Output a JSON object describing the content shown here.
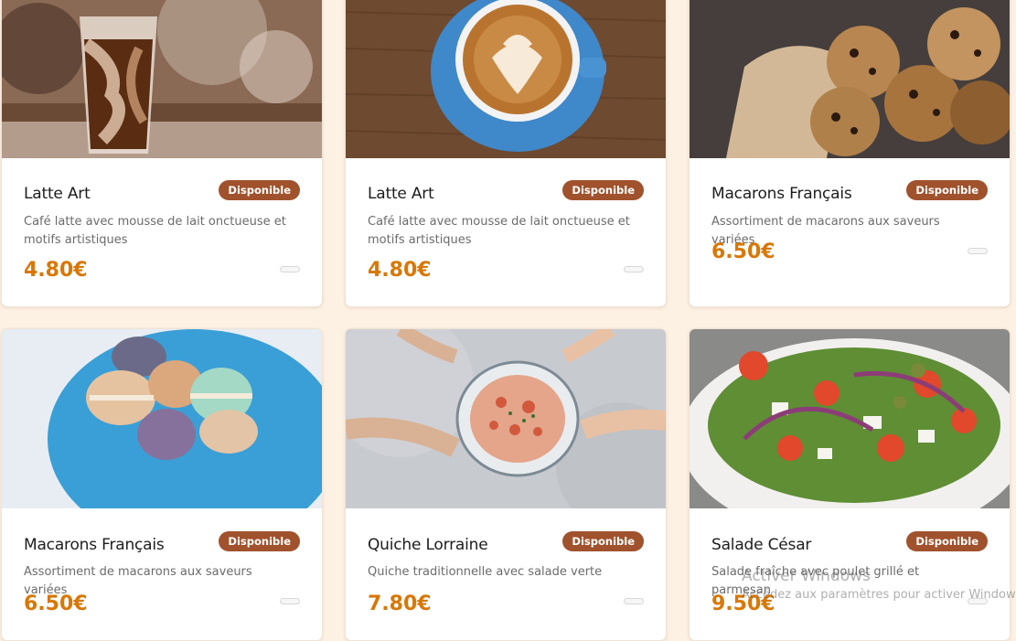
{
  "products": [
    {
      "title": "Latte Art",
      "status": "Disponible",
      "description": "Café latte avec mousse de lait onctueuse et motifs artistiques",
      "price": "4.80€",
      "image": "iced-coffee-photo"
    },
    {
      "title": "Latte Art",
      "status": "Disponible",
      "description": "Café latte avec mousse de lait onctueuse et motifs artistiques",
      "price": "4.80€",
      "image": "latte-art-cup-photo"
    },
    {
      "title": "Macarons Français",
      "status": "Disponible",
      "description": "Assortiment de macarons aux saveurs variées",
      "price": "6.50€",
      "image": "cookies-photo"
    },
    {
      "title": "Macarons Français",
      "status": "Disponible",
      "description": "Assortiment de macarons aux saveurs variées",
      "price": "6.50€",
      "image": "macarons-plate-photo"
    },
    {
      "title": "Quiche Lorraine",
      "status": "Disponible",
      "description": "Quiche traditionnelle avec salade verte",
      "price": "7.80€",
      "image": "shared-dish-photo"
    },
    {
      "title": "Salade César",
      "status": "Disponible",
      "description": "Salade fraîche avec poulet grillé et parmesan",
      "price": "9.50€",
      "image": "salad-bowl-photo"
    }
  ],
  "watermark": {
    "line1": "Activer Windows",
    "line2": "Accédez aux paramètres pour activer Windows."
  },
  "colors": {
    "badge": "#a0522d",
    "price": "#d97706",
    "background": "#fdf1e3"
  }
}
